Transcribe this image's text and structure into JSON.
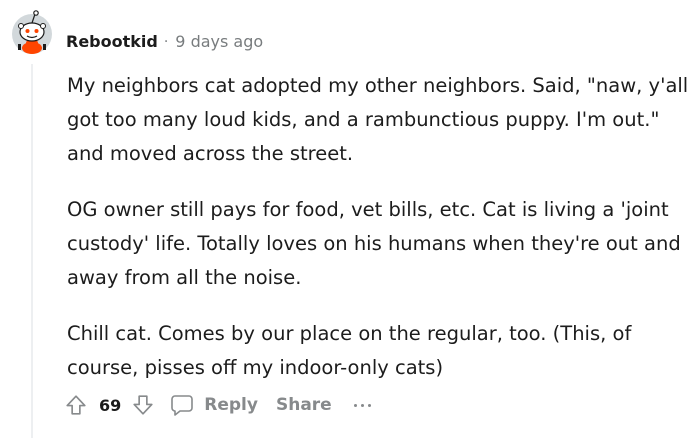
{
  "comment": {
    "username": "Rebootkid",
    "separator": "·",
    "time_ago": "9 days ago",
    "paragraphs": [
      "My neighbors cat adopted my other neighbors. Said, \"naw, y'all got too many loud kids, and a rambunctious puppy. I'm out.\" and moved across the street.",
      "OG owner still pays for food, vet bills, etc. Cat is living a 'joint custody' life. Totally loves on his humans when they're out and away from all the noise.",
      "Chill cat. Comes by our place on the regular, too. (This, of course, pisses off my indoor-only cats)"
    ]
  },
  "actions": {
    "score": "69",
    "reply_label": "Reply",
    "share_label": "Share"
  },
  "icons": {
    "avatar": "snoo-avatar-icon",
    "upvote": "arrow-up-icon",
    "downvote": "arrow-down-icon",
    "reply": "speech-bubble-icon",
    "more": "ellipsis-icon"
  },
  "colors": {
    "text": "#1c1c1c",
    "meta": "#787c7e",
    "action": "#878a8c",
    "avatar_bg": "#d2d8db",
    "avatar_accent": "#ff4500",
    "thread_line": "#edeff1"
  }
}
